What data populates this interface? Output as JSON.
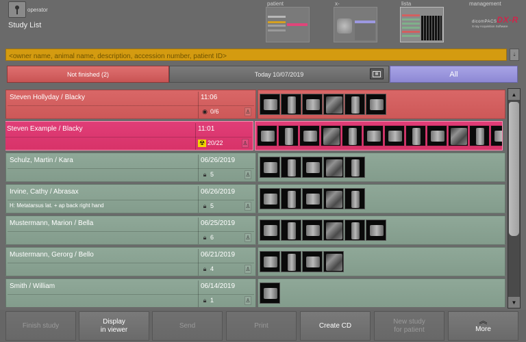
{
  "header": {
    "operator_label": "operator",
    "page_title": "Study List",
    "nav": [
      {
        "label": "patient",
        "active": false
      },
      {
        "label": "x-ray",
        "active": false
      },
      {
        "label": "lista",
        "active": true
      },
      {
        "label": "management",
        "active": false
      }
    ],
    "logo": {
      "brand": "dicomPACS",
      "product": "DX-R",
      "tagline": "X-ray Acquisition Software"
    }
  },
  "search": {
    "placeholder": "<owner name, animal name, description, accession number, patient ID>",
    "value": ""
  },
  "filters": {
    "not_finished": "Not finished (2)",
    "today": "Today 10/07/2019",
    "calendar_icon": "calendar-icon",
    "all": "All"
  },
  "studies": [
    {
      "name": "Steven Hollyday / Blacky",
      "when": "11:06",
      "description": "",
      "status_icon": "eye-icon",
      "count": "0/6",
      "thumbnails": 6,
      "color": "#d35f5f"
    },
    {
      "name": "Steven Example / Blacky",
      "when": "11:01",
      "description": "",
      "status_icon": "radiation-icon",
      "count": "20/22",
      "thumbnails": 12,
      "color": "#dc376e"
    },
    {
      "name": "Schulz, Martin / Kara",
      "when": "06/26/2019",
      "description": "",
      "status_icon": "lock-icon",
      "count": "5",
      "thumbnails": 5,
      "color": "#89a292"
    },
    {
      "name": "Irvine, Cathy / Abrasax",
      "when": "06/26/2019",
      "description": "H: Metatarsus lat. + ap back right hand",
      "status_icon": "lock-icon",
      "count": "5",
      "thumbnails": 5,
      "color": "#89a292"
    },
    {
      "name": "Mustermann, Marion / Bella",
      "when": "06/25/2019",
      "description": "",
      "status_icon": "lock-icon",
      "count": "6",
      "thumbnails": 6,
      "color": "#89a292"
    },
    {
      "name": "Mustermann, Gerorg / Bello",
      "when": "06/21/2019",
      "description": "",
      "status_icon": "lock-icon",
      "count": "4",
      "thumbnails": 4,
      "color": "#89a292"
    },
    {
      "name": "Smith / William",
      "when": "06/14/2019",
      "description": "",
      "status_icon": "lock-icon",
      "count": "1",
      "thumbnails": 1,
      "color": "#89a292"
    }
  ],
  "toolbar": {
    "finish_study": "Finish study",
    "display_in_viewer_1": "Display",
    "display_in_viewer_2": "in viewer",
    "send": "Send",
    "print": "Print",
    "create_cd": "Create CD",
    "new_study_1": "New study",
    "new_study_2": "for patient",
    "more": "More"
  }
}
